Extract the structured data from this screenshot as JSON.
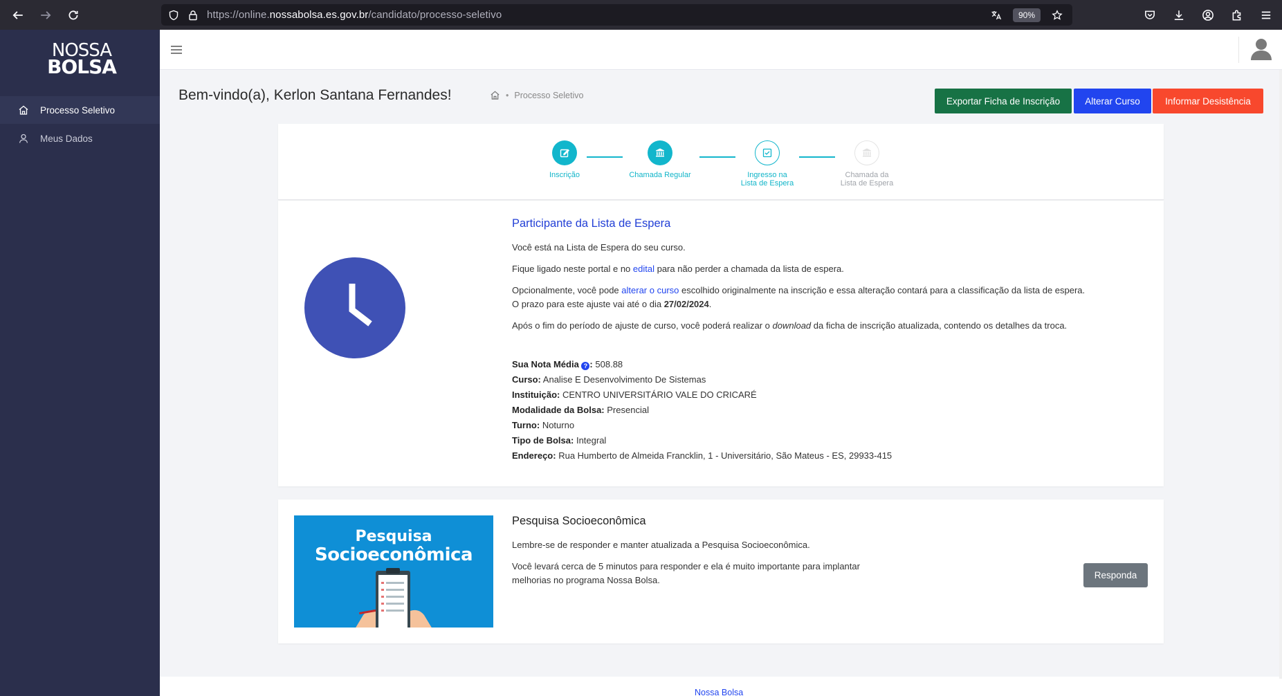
{
  "browser": {
    "url_prefix": "https://online.",
    "url_host": "nossabolsa.es.gov.br",
    "url_path": "/candidato/processo-seletivo",
    "zoom": "90%"
  },
  "sidebar": {
    "logo_line1": "NOSSA",
    "logo_line2": "BOLSA",
    "items": [
      {
        "label": "Processo Seletivo",
        "icon": "home-icon",
        "active": true
      },
      {
        "label": "Meus Dados",
        "icon": "user-icon",
        "active": false
      }
    ]
  },
  "page": {
    "title": "Bem-vindo(a), Kerlon Santana Fernandes!",
    "breadcrumb": "Processo Seletivo",
    "actions": {
      "export": "Exportar Ficha de Inscrição",
      "alter": "Alterar Curso",
      "desist": "Informar Desistência"
    }
  },
  "stepper": {
    "steps": [
      {
        "line1": "Inscrição",
        "line2": "",
        "status": "done",
        "icon": "edit-icon"
      },
      {
        "line1": "Chamada Regular",
        "line2": "",
        "status": "done",
        "icon": "bank-icon"
      },
      {
        "line1": "Ingresso na",
        "line2": "Lista de Espera",
        "status": "current",
        "icon": "check-square-icon"
      },
      {
        "line1": "Chamada da",
        "line2": "Lista de Espera",
        "status": "pending",
        "icon": "bank-icon"
      }
    ]
  },
  "info": {
    "title": "Participante da Lista de Espera",
    "p1": "Você está na Lista de Espera do seu curso.",
    "p2_before": "Fique ligado neste portal e no ",
    "p2_link": "edital",
    "p2_after": " para não perder a chamada da lista de espera.",
    "p3_before": "Opcionalmente, você pode ",
    "p3_link": "alterar o curso",
    "p3_after": " escolhido originalmente na inscrição e essa alteração contará para a classificação da lista de espera.",
    "p3_line2_before": "O prazo para este ajuste vai até o dia ",
    "p3_date": "27/02/2024",
    "p3_line2_after": ".",
    "p4_before": "Após o fim do período de ajuste de curso, você poderá realizar o ",
    "p4_em": "download",
    "p4_after": " da ficha de inscrição atualizada, contendo os detalhes da troca.",
    "fields": {
      "nota_label": "Sua Nota Média",
      "nota_value": "508.88",
      "curso_label": "Curso:",
      "curso_value": "Analise E Desenvolvimento De Sistemas",
      "inst_label": "Instituição:",
      "inst_value": "CENTRO UNIVERSITÁRIO VALE DO CRICARÉ",
      "mod_label": "Modalidade da Bolsa:",
      "mod_value": "Presencial",
      "turno_label": "Turno:",
      "turno_value": "Noturno",
      "tipo_label": "Tipo de Bolsa:",
      "tipo_value": "Integral",
      "end_label": "Endereço:",
      "end_value": "Rua Humberto de Almeida Francklin, 1 - Universitário, São Mateus - ES, 29933-415"
    }
  },
  "survey": {
    "img_line1": "Pesquisa",
    "img_line2": "Socioeconômica",
    "title": "Pesquisa Socioeconômica",
    "p1": "Lembre-se de responder e manter atualizada a Pesquisa Socioeconômica.",
    "p2_line1": "Você levará cerca de 5 minutos para responder e ela é muito importante para implantar",
    "p2_line2": "melhorias no programa Nossa Bolsa.",
    "button": "Responda"
  },
  "footer": {
    "link": "Nossa Bolsa"
  },
  "colors": {
    "sidebar_bg": "#2b2f4c",
    "accent_blue": "#2145ef",
    "teal": "#12b6cc",
    "export_green": "#177245",
    "desist_red": "#f8482d",
    "clock_blue": "#3f51b5"
  }
}
